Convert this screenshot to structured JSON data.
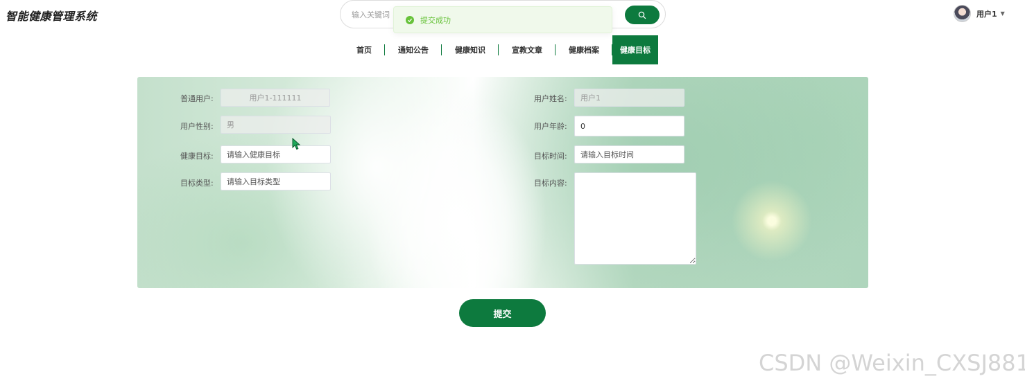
{
  "header": {
    "logo": "智能健康管理系统",
    "search": {
      "placeholder": "输入关键词"
    },
    "user": {
      "name": "用户1"
    }
  },
  "toast": {
    "message": "提交成功",
    "type": "success"
  },
  "nav": {
    "items": [
      "首页",
      "通知公告",
      "健康知识",
      "宣教文章",
      "健康档案",
      "健康目标"
    ],
    "active_index": 5
  },
  "form": {
    "left": {
      "user_label": "普通用户:",
      "user_value": "用户1-111111",
      "gender_label": "用户性别:",
      "gender_value": "男",
      "goal_label": "健康目标:",
      "goal_placeholder": "请输入健康目标",
      "type_label": "目标类型:",
      "type_placeholder": "请输入目标类型"
    },
    "right": {
      "name_label": "用户姓名:",
      "name_value": "用户1",
      "age_label": "用户年龄:",
      "age_value": "0",
      "time_label": "目标时间:",
      "time_placeholder": "请输入目标时间",
      "content_label": "目标内容:"
    },
    "submit_label": "提交"
  },
  "colors": {
    "primary": "#0d7a3e",
    "success": "#67c23a",
    "toast_bg": "#f0f9eb"
  },
  "watermark": "CSDN @Weixin_CXSJ881"
}
